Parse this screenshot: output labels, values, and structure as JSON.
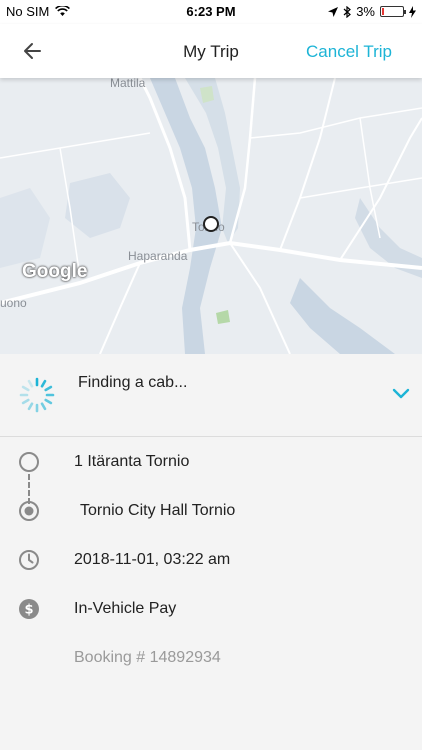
{
  "status_bar": {
    "carrier": "No SIM",
    "time": "6:23 PM",
    "battery": "3%"
  },
  "header": {
    "title": "My Trip",
    "cancel_label": "Cancel Trip"
  },
  "map": {
    "labels": {
      "mattila": "Mattila",
      "tornio": "Tornio",
      "haparanda": "Haparanda",
      "left_edge": "uono"
    },
    "logo_text": "Google"
  },
  "trip_status": {
    "text": "Finding a cab..."
  },
  "trip": {
    "pickup": "1 Itäranta Tornio",
    "dropoff": "Tornio City Hall Tornio",
    "datetime": "2018-11-01, 03:22 am",
    "payment": "In-Vehicle Pay",
    "booking": "Booking # 14892934"
  },
  "colors": {
    "accent": "#1db4d6",
    "battery_low": "#e53935"
  }
}
